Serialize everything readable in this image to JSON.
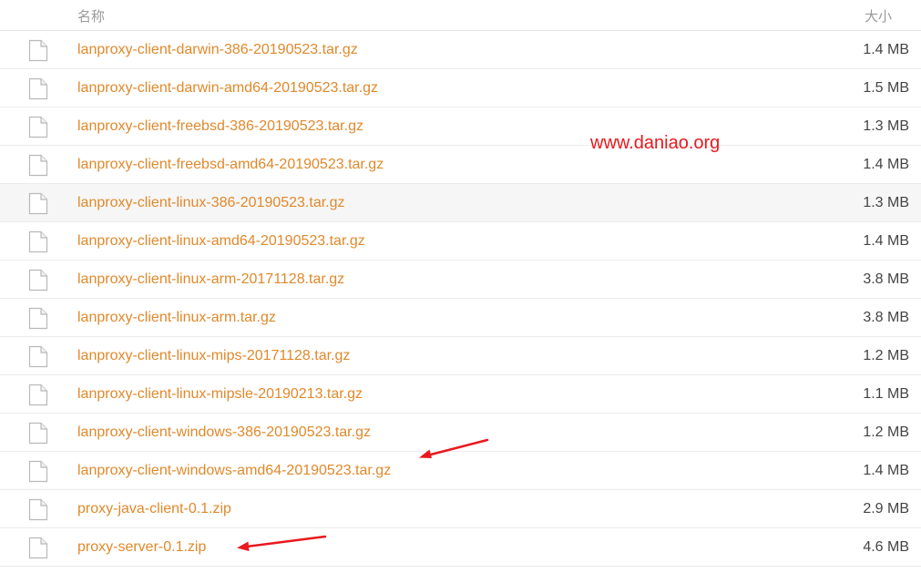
{
  "header": {
    "name_label": "名称",
    "size_label": "大小"
  },
  "files": [
    {
      "name": "lanproxy-client-darwin-386-20190523.tar.gz",
      "size": "1.4 MB"
    },
    {
      "name": "lanproxy-client-darwin-amd64-20190523.tar.gz",
      "size": "1.5 MB"
    },
    {
      "name": "lanproxy-client-freebsd-386-20190523.tar.gz",
      "size": "1.3 MB"
    },
    {
      "name": "lanproxy-client-freebsd-amd64-20190523.tar.gz",
      "size": "1.4 MB"
    },
    {
      "name": "lanproxy-client-linux-386-20190523.tar.gz",
      "size": "1.3 MB"
    },
    {
      "name": "lanproxy-client-linux-amd64-20190523.tar.gz",
      "size": "1.4 MB"
    },
    {
      "name": "lanproxy-client-linux-arm-20171128.tar.gz",
      "size": "3.8 MB"
    },
    {
      "name": "lanproxy-client-linux-arm.tar.gz",
      "size": "3.8 MB"
    },
    {
      "name": "lanproxy-client-linux-mips-20171128.tar.gz",
      "size": "1.2 MB"
    },
    {
      "name": "lanproxy-client-linux-mipsle-20190213.tar.gz",
      "size": "1.1 MB"
    },
    {
      "name": "lanproxy-client-windows-386-20190523.tar.gz",
      "size": "1.2 MB"
    },
    {
      "name": "lanproxy-client-windows-amd64-20190523.tar.gz",
      "size": "1.4 MB"
    },
    {
      "name": "proxy-java-client-0.1.zip",
      "size": "2.9 MB"
    },
    {
      "name": "proxy-server-0.1.zip",
      "size": "4.6 MB"
    }
  ],
  "watermark": "www.daniao.org",
  "colors": {
    "link": "#e0892b",
    "annotation": "#e8191e",
    "size_text": "#444444",
    "header_text": "#9a9a9a"
  },
  "icons": {
    "file": "file-icon",
    "annotation_arrow": "arrow-icon"
  }
}
